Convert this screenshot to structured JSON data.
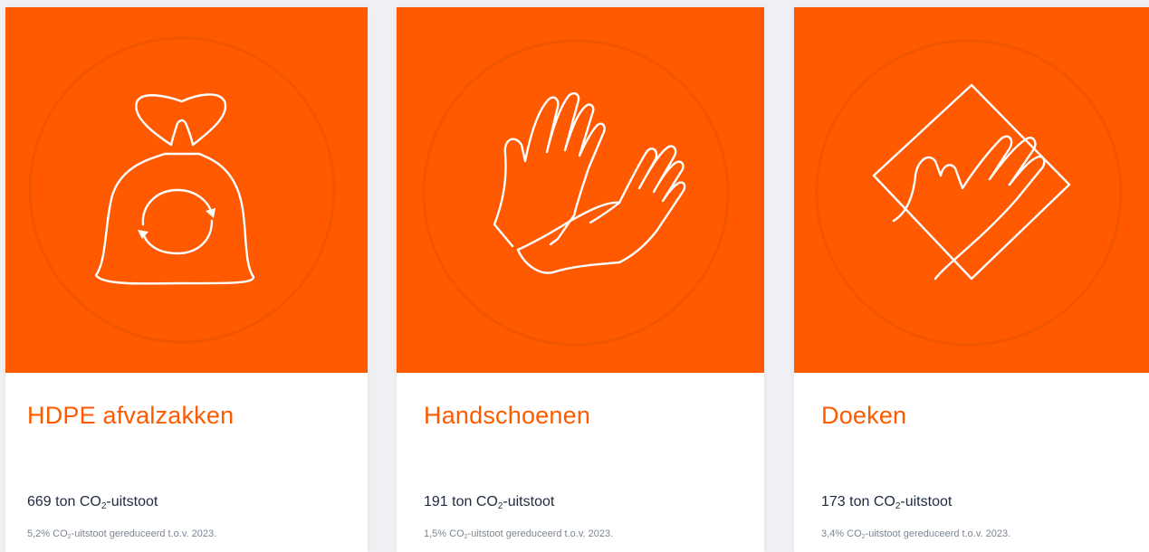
{
  "colors": {
    "accent": "#ff5a00",
    "text_dark": "#1d2a3f",
    "text_muted": "#7b8594"
  },
  "cards": [
    {
      "icon": "recycle-bag-icon",
      "title": "HDPE afvalzakken",
      "stat_value": "669 ton CO",
      "stat_sub": "2",
      "stat_suffix": "-uitstoot",
      "note_value": "5,2% CO",
      "note_sub": "2",
      "note_suffix": "-uitstoot gereduceerd t.o.v. 2023."
    },
    {
      "icon": "gloves-icon",
      "title": "Handschoenen",
      "stat_value": "191 ton CO",
      "stat_sub": "2",
      "stat_suffix": "-uitstoot",
      "note_value": "1,5% CO",
      "note_sub": "2",
      "note_suffix": "-uitstoot gereduceerd t.o.v. 2023."
    },
    {
      "icon": "cleaning-cloth-icon",
      "title": "Doeken",
      "stat_value": "173 ton CO",
      "stat_sub": "2",
      "stat_suffix": "-uitstoot",
      "note_value": "3,4% CO",
      "note_sub": "2",
      "note_suffix": "-uitstoot gereduceerd t.o.v. 2023."
    }
  ]
}
